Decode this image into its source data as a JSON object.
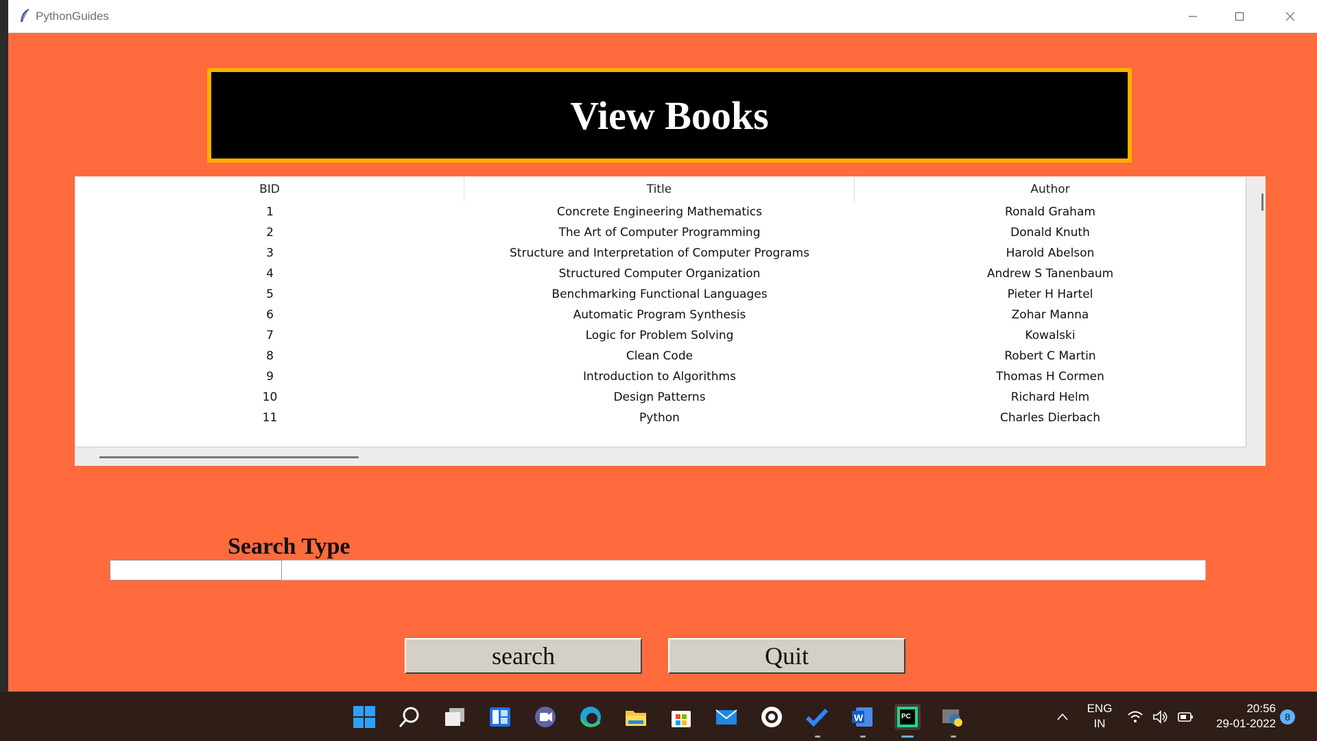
{
  "window": {
    "title": "PythonGuides",
    "controls": [
      "minimize-icon",
      "maximize-icon",
      "close-icon"
    ]
  },
  "header": {
    "title": "View Books",
    "border_color": "#ffb000",
    "background": "#000000"
  },
  "colors": {
    "window_bg": "#ff6b3d",
    "button_bg": "#d4d0c8",
    "taskbar_bg": "#2f1d18"
  },
  "table": {
    "columns": [
      "BID",
      "Title",
      "Author"
    ],
    "rows": [
      [
        "1",
        "Concrete Engineering Mathematics",
        "Ronald Graham"
      ],
      [
        "2",
        "The Art of Computer Programming",
        "Donald Knuth"
      ],
      [
        "3",
        "Structure and Interpretation of Computer Programs",
        "Harold Abelson"
      ],
      [
        "4",
        "Structured Computer Organization",
        "Andrew S Tanenbaum"
      ],
      [
        "5",
        "Benchmarking Functional Languages",
        "Pieter H Hartel"
      ],
      [
        "6",
        "Automatic Program Synthesis",
        "Zohar Manna"
      ],
      [
        "7",
        "Logic for Problem Solving",
        "Kowalski"
      ],
      [
        "8",
        "Clean Code",
        "Robert C Martin"
      ],
      [
        "9",
        "Introduction to Algorithms",
        "Thomas H Cormen"
      ],
      [
        "10",
        "Design Patterns",
        "Richard Helm"
      ],
      [
        "11",
        "Python",
        "Charles Dierbach"
      ]
    ]
  },
  "search": {
    "label": "Search Type",
    "value": ""
  },
  "buttons": {
    "search_label": "search",
    "quit_label": "Quit"
  },
  "taskbar": {
    "apps": [
      "windows-start-icon",
      "search-icon",
      "task-view-icon",
      "widgets-icon",
      "chat-icon",
      "edge-icon",
      "file-explorer-icon",
      "store-icon",
      "mail-icon",
      "github-icon",
      "todo-icon",
      "word-icon",
      "pycharm-icon",
      "python-icon"
    ],
    "language_line1": "ENG",
    "language_line2": "IN",
    "time": "20:56",
    "date": "29-01-2022",
    "notification_count": "8"
  }
}
